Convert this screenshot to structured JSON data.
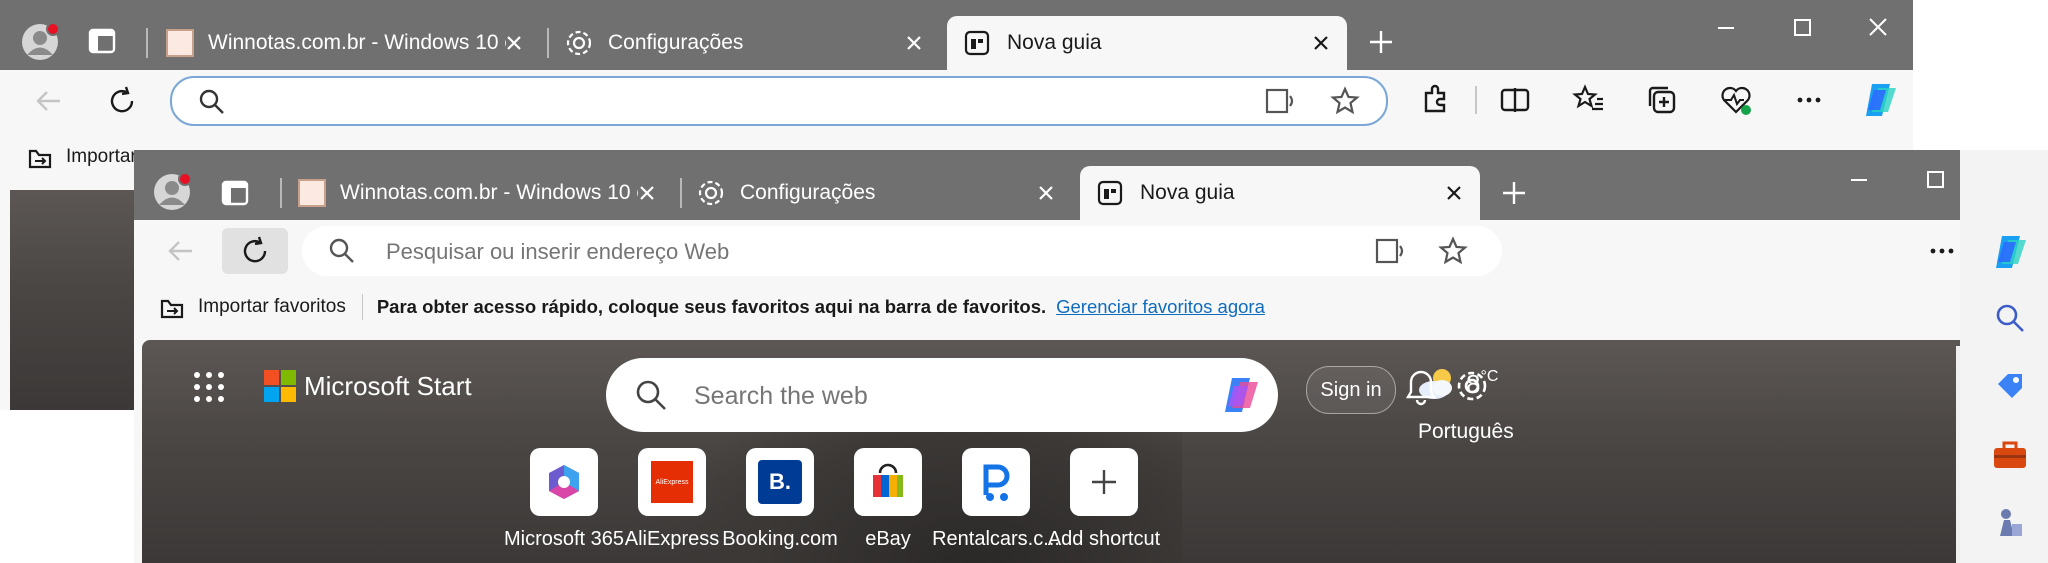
{
  "colors": {
    "tabstrip": "#707070",
    "accent": "#0f6cbd",
    "link": "#0f6cbd",
    "toolbar": "#f7f7f7"
  },
  "back_window": {
    "tabs": [
      {
        "label": "Winnotas.com.br - Windows 10 e"
      },
      {
        "label": "Configurações"
      },
      {
        "label": "Nova guia"
      }
    ],
    "favbar_label": "Importar",
    "icons": [
      "profile-icon",
      "tab-actions-icon",
      "add-tab-icon",
      "back-icon",
      "refresh-icon",
      "search-icon",
      "read-aloud-icon",
      "favorite-star-icon",
      "extensions-icon",
      "split-screen-icon",
      "favorites-icon",
      "collections-icon",
      "browser-essentials-icon",
      "more-icon",
      "copilot-icon"
    ]
  },
  "front_window": {
    "tabs": [
      {
        "label": "Winnotas.com.br - Windows 10 e"
      },
      {
        "label": "Configurações"
      },
      {
        "label": "Nova guia"
      }
    ],
    "address": {
      "placeholder": "Pesquisar ou inserir endereço Web",
      "value": ""
    },
    "favbar": {
      "import_label": "Importar favoritos",
      "message": "Para obter acesso rápido, coloque seus favoritos aqui na barra de favoritos.",
      "manage_link": "Gerenciar favoritos agora"
    },
    "sidebar_icons": [
      "copilot-icon",
      "search-icon",
      "shopping-tag-icon",
      "tools-icon",
      "games-icon"
    ]
  },
  "newtab": {
    "brand": "Microsoft Start",
    "search_placeholder": "Search the web",
    "sign_in": "Sign in",
    "temperature": "8",
    "temp_unit": "°C",
    "language": "Português",
    "shortcuts": [
      {
        "label": "Microsoft 365",
        "icon": "microsoft-365-icon"
      },
      {
        "label": "AliExpress",
        "icon": "aliexpress-icon",
        "icon_text": "AliExpress"
      },
      {
        "label": "Booking.com",
        "icon": "booking-icon",
        "icon_text": "B."
      },
      {
        "label": "eBay",
        "icon": "ebay-icon"
      },
      {
        "label": "Rentalcars.c...",
        "icon": "rentalcars-icon"
      },
      {
        "label": "Add shortcut",
        "icon": "add-icon"
      }
    ]
  }
}
